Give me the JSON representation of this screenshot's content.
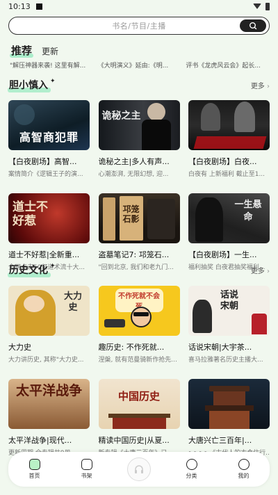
{
  "status": {
    "time": "10:13"
  },
  "search": {
    "placeholder": "书名/节目/主播"
  },
  "tabs": {
    "active": "推荐",
    "other": "更新"
  },
  "ticker": [
    "\"解压神器来袭! 这里有解...",
    "《大明演义》延由:《明...",
    "评书《龙虎风云会》起长..."
  ],
  "sections": [
    {
      "title": "胆小慎入",
      "more": "更多",
      "items": [
        {
          "title": "【白夜剧场】高智...",
          "sub": "案情简介《逻辑王子的演...",
          "cover_text": "高智商犯罪"
        },
        {
          "title": "诡秘之主|多人有声...",
          "sub": "心潮澎湃, 无限幻想, 迎...",
          "cover_text": "诡秘之主"
        },
        {
          "title": "【白夜剧场】白夜...",
          "sub": "白夜有 上新福利 截止至1...",
          "cover_text": ""
        },
        {
          "title": "道士不好惹|全新重...",
          "sub": "全网点击50亿道术流十大...",
          "cover_text": "道士不好惹"
        },
        {
          "title": "盗墓笔记7: 邛笼石...",
          "sub": "\"回到北京, 我们和老九门...",
          "cover_text": "邛笼石影"
        },
        {
          "title": "【白夜剧场】一生...",
          "sub": "福利抽奖 白夜君抽奖福利...",
          "cover_text": "一生悬命"
        }
      ]
    },
    {
      "title": "历史文化",
      "more": "更多",
      "items": [
        {
          "title": "大力史",
          "sub": "大力讲历史, 其称\"大力史...",
          "cover_text": "大力史"
        },
        {
          "title": "趣历史: 不作死就...",
          "sub": "涅槃, 就有范曼骑新作抢先...",
          "cover_text": "不作死就不会死"
        },
        {
          "title": "话说宋朝|大宇茶...",
          "sub": "喜马拉雅著名历史主播大...",
          "cover_text": "话说宋朝"
        },
        {
          "title": "太平洋战争|现代...",
          "sub": "更新周期 全专辑共9册,...",
          "cover_text": "太平洋战争"
        },
        {
          "title": "精读中国历史|从夏...",
          "sub": "新专辑《大唐三百年》已...",
          "cover_text": "中国历史"
        },
        {
          "title": "大唐兴亡三百年|...",
          "sub": ">>>>《古代人的衣食住行...",
          "cover_text": ""
        }
      ]
    }
  ],
  "nav": {
    "home": "首页",
    "shelf": "书架",
    "category": "分类",
    "mine": "我的"
  }
}
